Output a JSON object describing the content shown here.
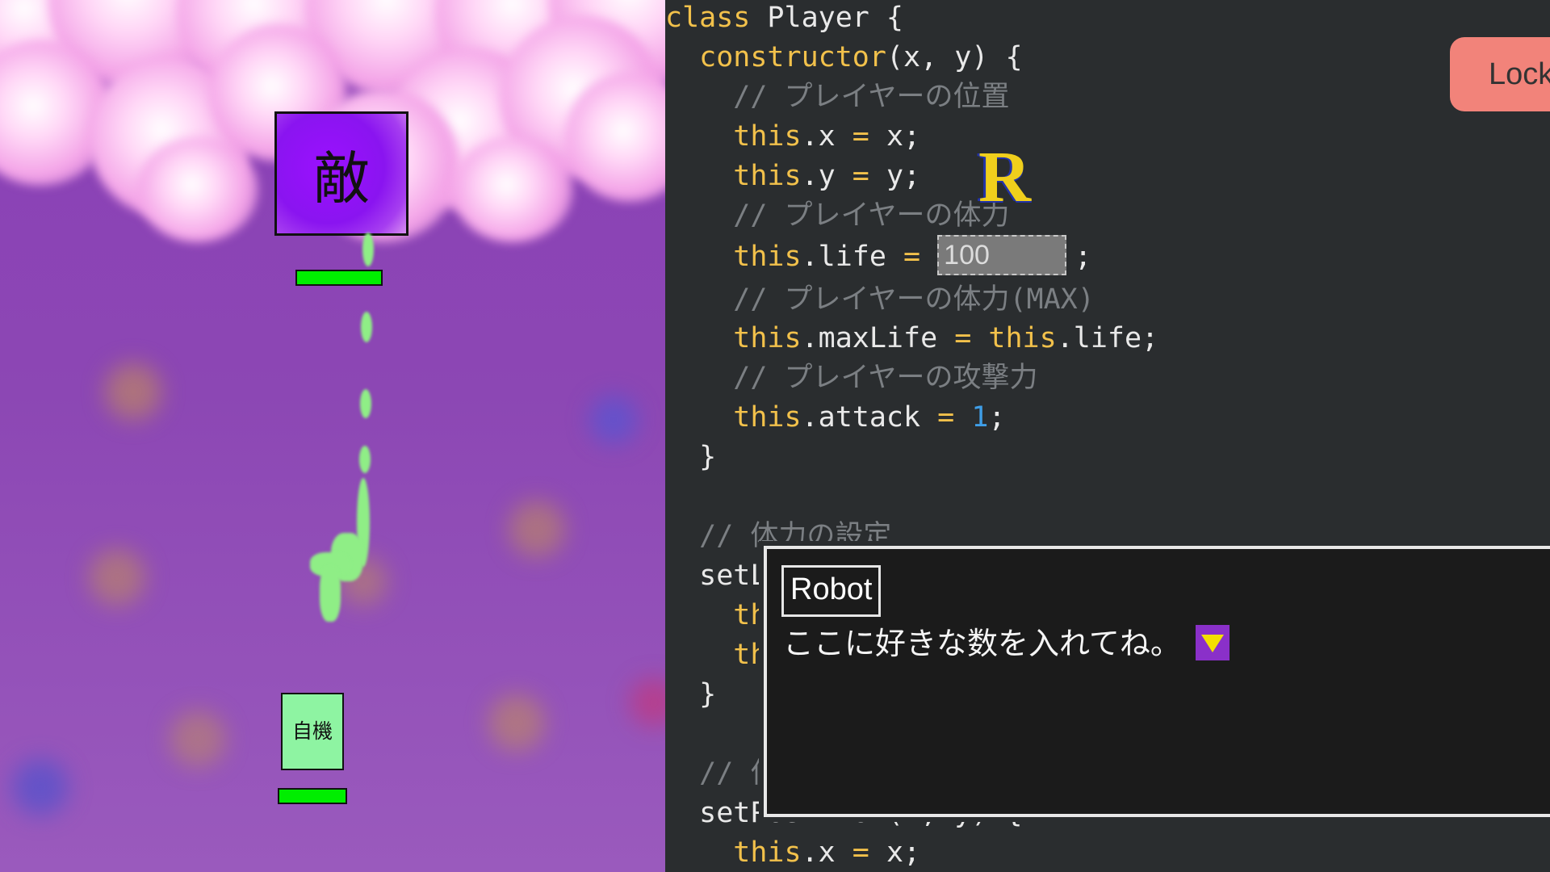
{
  "game": {
    "enemy_label": "敵",
    "player_label": "自機",
    "enemy_hp": 1.0,
    "player_hp": 1.0
  },
  "editor": {
    "lines": [
      {
        "parts": [
          {
            "t": "class",
            "c": "kw"
          },
          {
            "t": " Player {",
            "c": ""
          }
        ]
      },
      {
        "parts": [
          {
            "t": "  constructor",
            "c": "kw"
          },
          {
            "t": "(x, y) {",
            "c": ""
          }
        ]
      },
      {
        "parts": [
          {
            "t": "    // プレイヤーの位置",
            "c": "cmt"
          }
        ]
      },
      {
        "parts": [
          {
            "t": "    this",
            "c": "kw"
          },
          {
            "t": ".x ",
            "c": ""
          },
          {
            "t": "=",
            "c": "op"
          },
          {
            "t": " x;",
            "c": ""
          }
        ]
      },
      {
        "parts": [
          {
            "t": "    this",
            "c": "kw"
          },
          {
            "t": ".y ",
            "c": ""
          },
          {
            "t": "=",
            "c": "op"
          },
          {
            "t": " y;",
            "c": ""
          }
        ]
      },
      {
        "parts": [
          {
            "t": "    // プレイヤーの体力",
            "c": "cmt"
          }
        ]
      },
      {
        "parts": [
          {
            "t": "    this",
            "c": "kw"
          },
          {
            "t": ".life ",
            "c": ""
          },
          {
            "t": "=",
            "c": "op"
          },
          {
            "t": " ",
            "c": ""
          }
        ],
        "input": true,
        "after": ";"
      },
      {
        "parts": [
          {
            "t": "    // プレイヤーの体力(MAX)",
            "c": "cmt"
          }
        ]
      },
      {
        "parts": [
          {
            "t": "    this",
            "c": "kw"
          },
          {
            "t": ".maxLife ",
            "c": ""
          },
          {
            "t": "=",
            "c": "op"
          },
          {
            "t": " ",
            "c": ""
          },
          {
            "t": "this",
            "c": "kw"
          },
          {
            "t": ".life;",
            "c": ""
          }
        ]
      },
      {
        "parts": [
          {
            "t": "    // プレイヤーの攻撃力",
            "c": "cmt"
          }
        ]
      },
      {
        "parts": [
          {
            "t": "    this",
            "c": "kw"
          },
          {
            "t": ".attack ",
            "c": ""
          },
          {
            "t": "=",
            "c": "op"
          },
          {
            "t": " ",
            "c": ""
          },
          {
            "t": "1",
            "c": "num"
          },
          {
            "t": ";",
            "c": ""
          }
        ]
      },
      {
        "parts": [
          {
            "t": "  }",
            "c": ""
          }
        ]
      },
      {
        "parts": [
          {
            "t": "",
            "c": ""
          }
        ]
      },
      {
        "parts": [
          {
            "t": "  // 体力の設定",
            "c": "cmt"
          }
        ]
      },
      {
        "parts": [
          {
            "t": "  setL",
            "c": ""
          }
        ]
      },
      {
        "parts": [
          {
            "t": "    th",
            "c": "kw"
          }
        ]
      },
      {
        "parts": [
          {
            "t": "    th",
            "c": "kw"
          }
        ]
      },
      {
        "parts": [
          {
            "t": "  }",
            "c": ""
          }
        ]
      },
      {
        "parts": [
          {
            "t": "",
            "c": ""
          }
        ]
      },
      {
        "parts": [
          {
            "t": "  // 位",
            "c": "cmt"
          }
        ]
      },
      {
        "parts": [
          {
            "t": "  setPosition(x, y) {",
            "c": ""
          }
        ]
      },
      {
        "parts": [
          {
            "t": "    this",
            "c": "kw"
          },
          {
            "t": ".x ",
            "c": ""
          },
          {
            "t": "=",
            "c": "op"
          },
          {
            "t": " x;",
            "c": ""
          }
        ]
      }
    ],
    "life_input_value": "100",
    "lock_button_label": "Lock",
    "marker_letter": "R"
  },
  "dialog": {
    "speaker": "Robot",
    "message": "ここに好きな数を入れてね。",
    "next_icon": "triangle-down-icon"
  },
  "colors": {
    "keyword": "#f2c14b",
    "comment": "#7b7f83",
    "number": "#3f9ee8",
    "hp_bar": "#00ee00",
    "lock_button": "#f2837a",
    "next_indicator_bg": "#8a30c9",
    "next_indicator_arrow": "#f3e000"
  }
}
